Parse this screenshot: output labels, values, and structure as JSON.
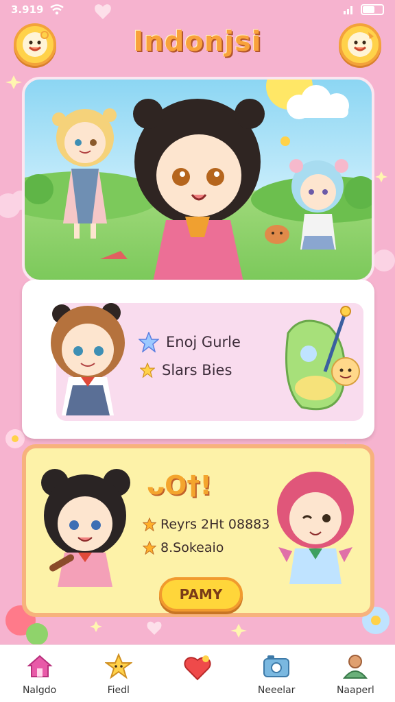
{
  "status_bar": {
    "time": "3.919",
    "battery_level": 0.6
  },
  "header": {
    "title": "Indonjsi",
    "left_avatar_icon": "smiley-mascot-icon",
    "right_avatar_icon": "smiley-mascot-icon"
  },
  "info_card": {
    "stats": [
      {
        "icon": "star-icon",
        "label": "Enoj Gurle"
      },
      {
        "icon": "star-icon",
        "label": "Slars Bies"
      }
    ]
  },
  "event_card": {
    "title": "ᴗO†!",
    "rows": [
      {
        "icon": "star-icon",
        "label": "Reyrs 2Ht 08883"
      },
      {
        "icon": "star-icon",
        "label": "8.Sokeaio"
      }
    ],
    "button_label": "PAMY"
  },
  "bottom_nav": [
    {
      "icon": "home-icon",
      "label": "Nalgdo"
    },
    {
      "icon": "star-friend-icon",
      "label": "Fiedl"
    },
    {
      "icon": "heart-icon",
      "label": ""
    },
    {
      "icon": "camera-icon",
      "label": "Neeelar"
    },
    {
      "icon": "profile-icon",
      "label": "Naaperl"
    }
  ],
  "colors": {
    "background": "#f6b3cf",
    "accent": "#f9a23b",
    "event_card": "#fdf2a8",
    "nav_active": "#e85aa8"
  }
}
